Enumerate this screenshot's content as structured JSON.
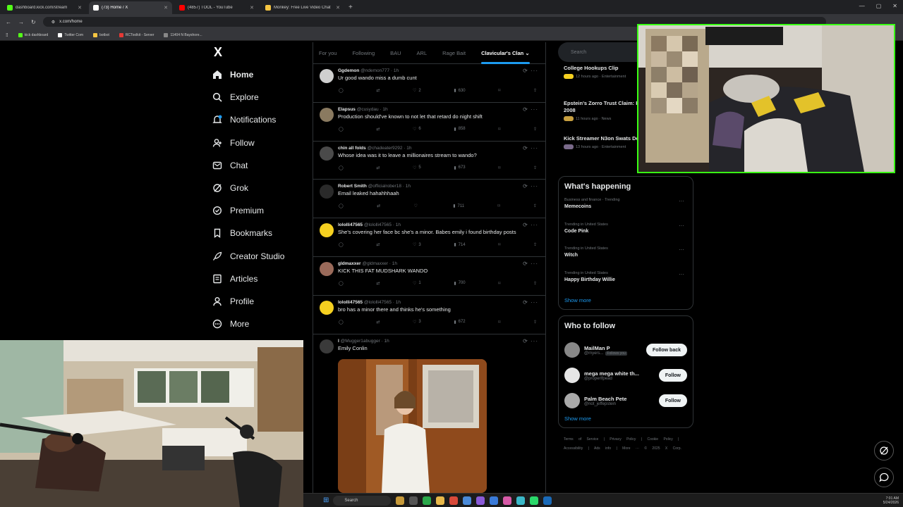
{
  "browser": {
    "tabs": [
      {
        "title": "dashboard.kick.com/stream",
        "color": "#53fc18"
      },
      {
        "title": "(73) Home / X",
        "color": "#ffffff"
      },
      {
        "title": "(4857) TOOL - YouTube",
        "color": "#ff0000"
      },
      {
        "title": "Monkey: Free Live Video Chat",
        "color": "#f5c542"
      }
    ],
    "new_tab": "+",
    "url": "x.com/home",
    "bookmarks": [
      {
        "label": "kick dashboard",
        "color": "#53fc18"
      },
      {
        "label": "Twitter Com",
        "color": "#ffffff"
      },
      {
        "label": "botbot",
        "color": "#f5c542"
      },
      {
        "label": "RCToolkit - Server",
        "color": "#e53935"
      },
      {
        "label": "11404 N Bayshore...",
        "color": "#888888"
      }
    ]
  },
  "x": {
    "logo": "X",
    "nav": [
      {
        "label": "Home",
        "icon": "home-icon",
        "bold": true
      },
      {
        "label": "Explore",
        "icon": "search-icon"
      },
      {
        "label": "Notifications",
        "icon": "bell-icon"
      },
      {
        "label": "Follow",
        "icon": "follow-icon"
      },
      {
        "label": "Chat",
        "icon": "chat-icon"
      },
      {
        "label": "Grok",
        "icon": "grok-icon"
      },
      {
        "label": "Premium",
        "icon": "premium-icon"
      },
      {
        "label": "Bookmarks",
        "icon": "bookmark-icon"
      },
      {
        "label": "Creator Studio",
        "icon": "rocket-icon"
      },
      {
        "label": "Articles",
        "icon": "article-icon"
      },
      {
        "label": "Profile",
        "icon": "profile-icon"
      },
      {
        "label": "More",
        "icon": "more-icon"
      }
    ],
    "feed_tabs": [
      "For you",
      "Following",
      "BAU",
      "ARL",
      "Rage Bait",
      "Clavicular's Clan"
    ],
    "active_tab": "Clavicular's Clan",
    "tweets": [
      {
        "name": "Ggdemon",
        "handle": "@ndemon777 · 1h",
        "text": "Ur good wando miss a dumb cunt",
        "likes": "2",
        "views": "630",
        "avatar": "#cfcfcf"
      },
      {
        "name": "Elapsus",
        "handle": "@cusydau · 1h",
        "text": "Production should've known to not let that retard do night shift",
        "likes": "6",
        "views": "858",
        "avatar": "#8a7a60"
      },
      {
        "name": "chin all folds",
        "handle": "@chadeater9292 · 1h",
        "text": "Whose idea was it to leave a millionaires stream to wando?",
        "likes": "5",
        "views": "673",
        "avatar": "#4a4a4a"
      },
      {
        "name": "Robert Smith",
        "handle": "@officialrober18 · 1h",
        "text": "Email leaked hahahhhaah",
        "likes": "",
        "views": "711",
        "avatar": "#2a2a2a"
      },
      {
        "name": "lololli47565",
        "handle": "@lololli47565 · 1h",
        "text": "She's covering her face bc she's a minor. Babes emily i found birthday posts",
        "likes": "3",
        "views": "714",
        "avatar": "#f5d020"
      },
      {
        "name": "gldmaxxer",
        "handle": "@gldmaxxer · 1h",
        "text": "KICK THIS FAT MUDSHARK WANDO",
        "likes": "1",
        "views": "700",
        "avatar": "#9a6a5a"
      },
      {
        "name": "lololli47565",
        "handle": "@lololli47565 · 1h",
        "text": "bro has a minor there and thinks he's something",
        "likes": "3",
        "views": "672",
        "avatar": "#f5d020"
      }
    ],
    "media_post": {
      "name": "I",
      "handle": "@Mugger1abugger · 1h",
      "text": "Emily Conlin"
    }
  },
  "sidebar": {
    "search_placeholder": "Search",
    "news": [
      {
        "title": "College Hookups Clip",
        "meta": "12 hours ago · Entertainment"
      },
      {
        "title": "Epstein's Zorro Trust Claim: Powerball Win in 2008",
        "meta": "11 hours ago · News"
      },
      {
        "title": "Kick Streamer N3on Swats Deputies in LA",
        "meta": "13 hours ago · Entertainment"
      }
    ],
    "happening_title": "What's happening",
    "trends": [
      {
        "context": "Business and finance · Trending",
        "name": "Memecoins"
      },
      {
        "context": "Trending in United States",
        "name": "Code Pink"
      },
      {
        "context": "Trending in United States",
        "name": "Witch"
      },
      {
        "context": "Trending in United States",
        "name": "Happy Birthday Willie"
      }
    ],
    "show_more": "Show more",
    "who_title": "Who to follow",
    "follow": [
      {
        "name": "MailMan P",
        "handle": "@myers...",
        "badge": "Follows you",
        "button": "Follow back",
        "avatar": "#888"
      },
      {
        "name": "mega mega white th...",
        "handle": "@properlfpead",
        "button": "Follow",
        "avatar": "#e6e6e6"
      },
      {
        "name": "Palm Beach Pete",
        "handle": "@not_jeffepstein",
        "button": "Follow",
        "avatar": "#aaa"
      }
    ],
    "footer": "Terms of Service | Privacy Policy | Cookie Policy | Accessibility | Ads info | More ··· © 2025 X Corp."
  },
  "taskbar": {
    "search": "Search",
    "time": "7:01 AM",
    "date": "5/24/2026"
  }
}
